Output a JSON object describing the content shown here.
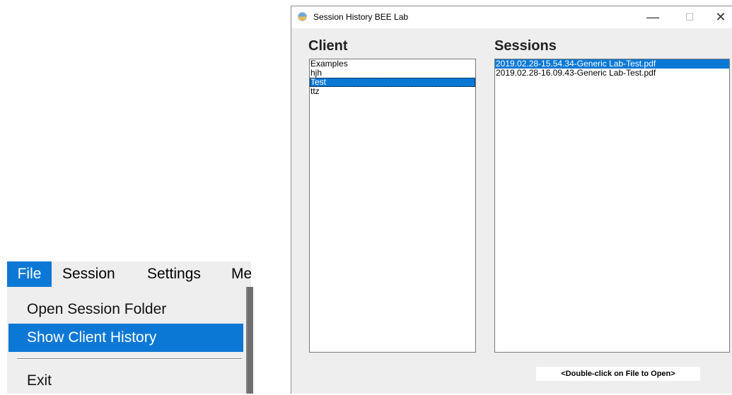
{
  "menubar": {
    "items": [
      {
        "label": "File"
      },
      {
        "label": "Session"
      },
      {
        "label": "Settings"
      },
      {
        "label": "Me"
      }
    ]
  },
  "file_menu": {
    "items": [
      {
        "label": "Open Session Folder"
      },
      {
        "label": "Show Client History"
      },
      {
        "label": "Exit"
      }
    ]
  },
  "window": {
    "title": "Session History BEE Lab",
    "controls": {
      "minimize": "—",
      "maximize": "☐",
      "close": "✕"
    },
    "client_heading": "Client",
    "sessions_heading": "Sessions",
    "clients": [
      "Examples",
      "hjh",
      "Test",
      "ttz"
    ],
    "selected_client": "Test",
    "sessions": [
      "2019.02.28-15.54.34-Generic Lab-Test.pdf",
      "2019.02.28-16.09.43-Generic Lab-Test.pdf"
    ],
    "selected_session": "2019.02.28-15.54.34-Generic Lab-Test.pdf",
    "hint": "<Double-click on File to Open>"
  },
  "colors": {
    "selection": "#0c78d6",
    "window_bg": "#eeeeee"
  }
}
